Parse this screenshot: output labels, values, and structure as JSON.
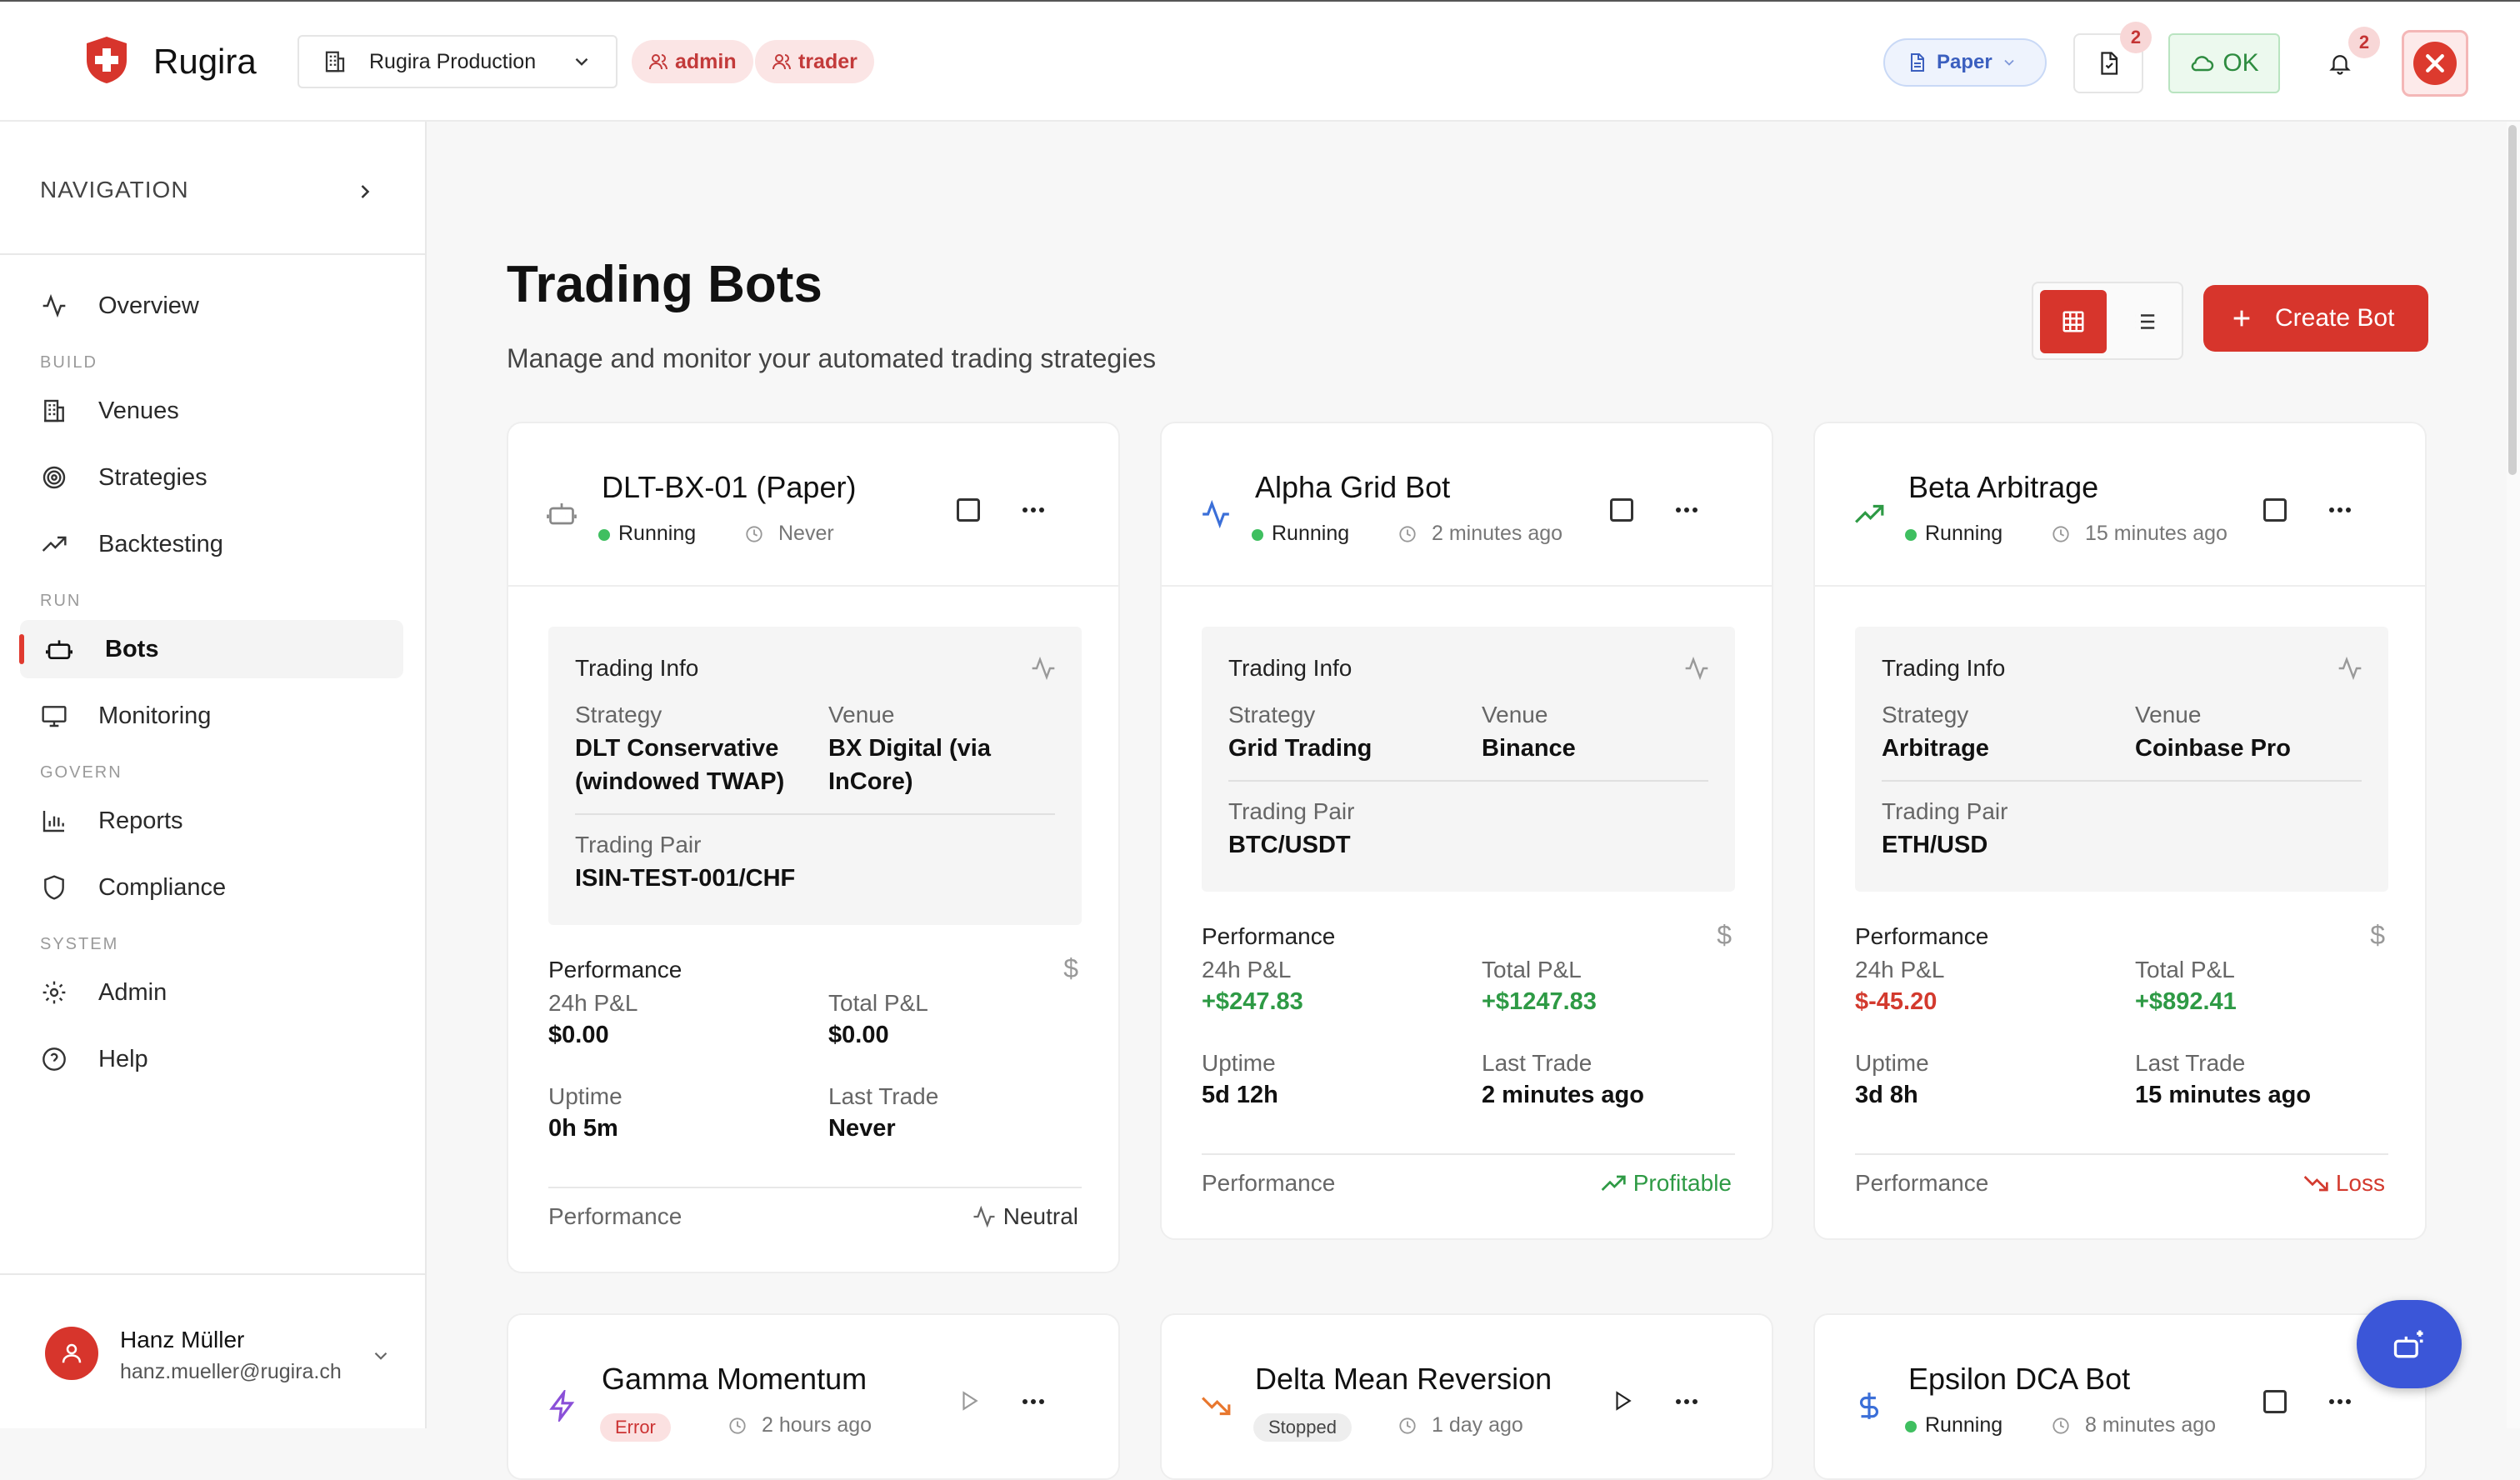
{
  "header": {
    "brand": "Rugira",
    "org_selector": "Rugira Production",
    "roles": [
      "admin",
      "trader"
    ],
    "mode": "Paper",
    "documents_badge": "2",
    "connection_status": "OK",
    "notifications_badge": "2"
  },
  "sidebar": {
    "heading": "NAVIGATION",
    "sections": {
      "build": "BUILD",
      "run": "RUN",
      "govern": "GOVERN",
      "system": "SYSTEM"
    },
    "items": {
      "overview": "Overview",
      "venues": "Venues",
      "strategies": "Strategies",
      "backtesting": "Backtesting",
      "bots": "Bots",
      "monitoring": "Monitoring",
      "reports": "Reports",
      "compliance": "Compliance",
      "admin": "Admin",
      "help": "Help"
    },
    "active_item": "bots",
    "user": {
      "name": "Hanz Müller",
      "email": "hanz.mueller@rugira.ch"
    }
  },
  "main": {
    "title": "Trading Bots",
    "subtitle": "Manage and monitor your automated trading strategies",
    "create_label": "Create Bot",
    "labels": {
      "trading_info": "Trading Info",
      "strategy": "Strategy",
      "venue": "Venue",
      "trading_pair": "Trading Pair",
      "performance": "Performance",
      "pnl_24h": "24h P&L",
      "total_pnl": "Total P&L",
      "uptime": "Uptime",
      "last_trade": "Last Trade",
      "dollar": "$"
    },
    "bots": [
      {
        "name": "DLT-BX-01 (Paper)",
        "status": "Running",
        "last_activity": "Never",
        "strategy_line1": "DLT Conservative",
        "strategy_line2": "(windowed TWAP)",
        "venue_line1": "BX Digital (via",
        "venue_line2": "InCore)",
        "pair": "ISIN-TEST-001/CHF",
        "pnl_24h": "$0.00",
        "total_pnl": "$0.00",
        "uptime": "0h 5m",
        "last_trade": "Never",
        "perf_status": "Neutral"
      },
      {
        "name": "Alpha Grid Bot",
        "status": "Running",
        "last_activity": "2 minutes ago",
        "strategy": "Grid Trading",
        "venue": "Binance",
        "pair": "BTC/USDT",
        "pnl_24h": "+$247.83",
        "total_pnl": "+$1247.83",
        "uptime": "5d 12h",
        "last_trade": "2 minutes ago",
        "perf_status": "Profitable"
      },
      {
        "name": "Beta Arbitrage",
        "status": "Running",
        "last_activity": "15 minutes ago",
        "strategy": "Arbitrage",
        "venue": "Coinbase Pro",
        "pair": "ETH/USD",
        "pnl_24h": "$-45.20",
        "total_pnl": "+$892.41",
        "uptime": "3d 8h",
        "last_trade": "15 minutes ago",
        "perf_status": "Loss"
      },
      {
        "name": "Gamma Momentum",
        "status": "Error",
        "last_activity": "2 hours ago"
      },
      {
        "name": "Delta Mean Reversion",
        "status": "Stopped",
        "last_activity": "1 day ago"
      },
      {
        "name": "Epsilon DCA Bot",
        "status": "Running",
        "last_activity": "8 minutes ago"
      }
    ]
  },
  "colors": {
    "accent": "#d7352c",
    "profit": "#2e9a45",
    "loss": "#d33a2e",
    "running": "#3fbf60",
    "paper": "#3b5fbf"
  }
}
